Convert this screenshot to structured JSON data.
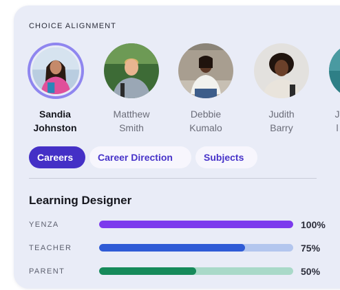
{
  "section": {
    "label": "CHOICE ALIGNMENT"
  },
  "people": [
    {
      "name": "Sandia\nJohnston",
      "selected": true
    },
    {
      "name": "Matthew\nSmith",
      "selected": false
    },
    {
      "name": "Debbie\nKumalo",
      "selected": false
    },
    {
      "name": "Judith\nBarry",
      "selected": false
    },
    {
      "name": "J\nl",
      "selected": false
    }
  ],
  "tabs": [
    {
      "label": "Careers",
      "active": true
    },
    {
      "label": "Career Direction",
      "active": false
    },
    {
      "label": "Subjects",
      "active": false
    }
  ],
  "role": {
    "title": "Learning Designer"
  },
  "alignment": [
    {
      "label": "YENZA",
      "value": "100%",
      "fraction": 1.0,
      "color": "#7c3aed",
      "track_color": "#cbb7f6"
    },
    {
      "label": "TEACHER",
      "value": "75%",
      "fraction": 0.75,
      "color": "#2f5bd6",
      "track_color": "#b3c6ee"
    },
    {
      "label": "PARENT",
      "value": "50%",
      "fraction": 0.5,
      "color": "#168a5a",
      "track_color": "#a9d9c8"
    }
  ]
}
